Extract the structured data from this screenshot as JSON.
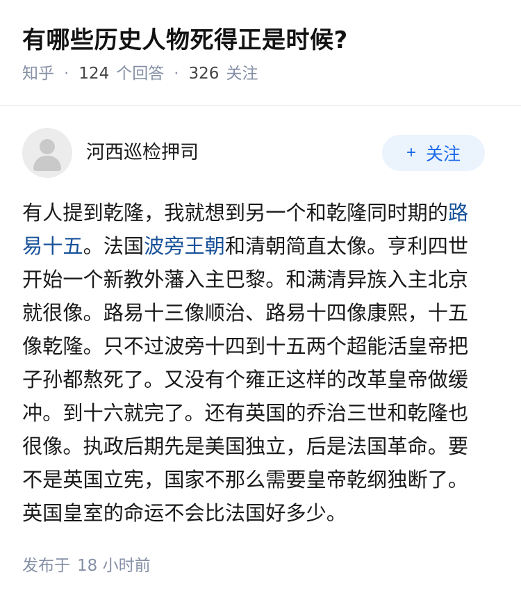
{
  "question": {
    "title": "有哪些历史人物死得正是时候?",
    "source": "知乎",
    "answer_count": "124",
    "answer_label": "个回答",
    "follow_count": "326",
    "follow_label": "关注"
  },
  "author": {
    "name": "河西巡检押司",
    "follow_button_plus": "+",
    "follow_button_label": "关注"
  },
  "answer": {
    "seg1": "有人提到乾隆，我就想到另一个和乾隆同时期的",
    "link1": "路易十五",
    "seg2": "。法国",
    "link2": "波旁王朝",
    "seg3": "和清朝简直太像。亨利四世开始一个新教外藩入主巴黎。和满清异族入主北京就很像。路易十三像顺治、路易十四像康熙，十五像乾隆。只不过波旁十四到十五两个超能活皇帝把子孙都熬死了。又没有个雍正这样的改革皇帝做缓冲。到十六就完了。还有英国的乔治三世和乾隆也很像。执政后期先是美国独立，后是法国革命。要不是英国立宪，国家不那么需要皇帝乾纲独断了。英国皇室的命运不会比法国好多少。"
  },
  "footer": {
    "published_label": "发布于",
    "published_time": "18 小时前"
  },
  "colors": {
    "link": "#175199",
    "follow_button_bg": "#ebf3fd",
    "follow_button_text": "#1768e8",
    "meta_text": "#8590a6"
  }
}
